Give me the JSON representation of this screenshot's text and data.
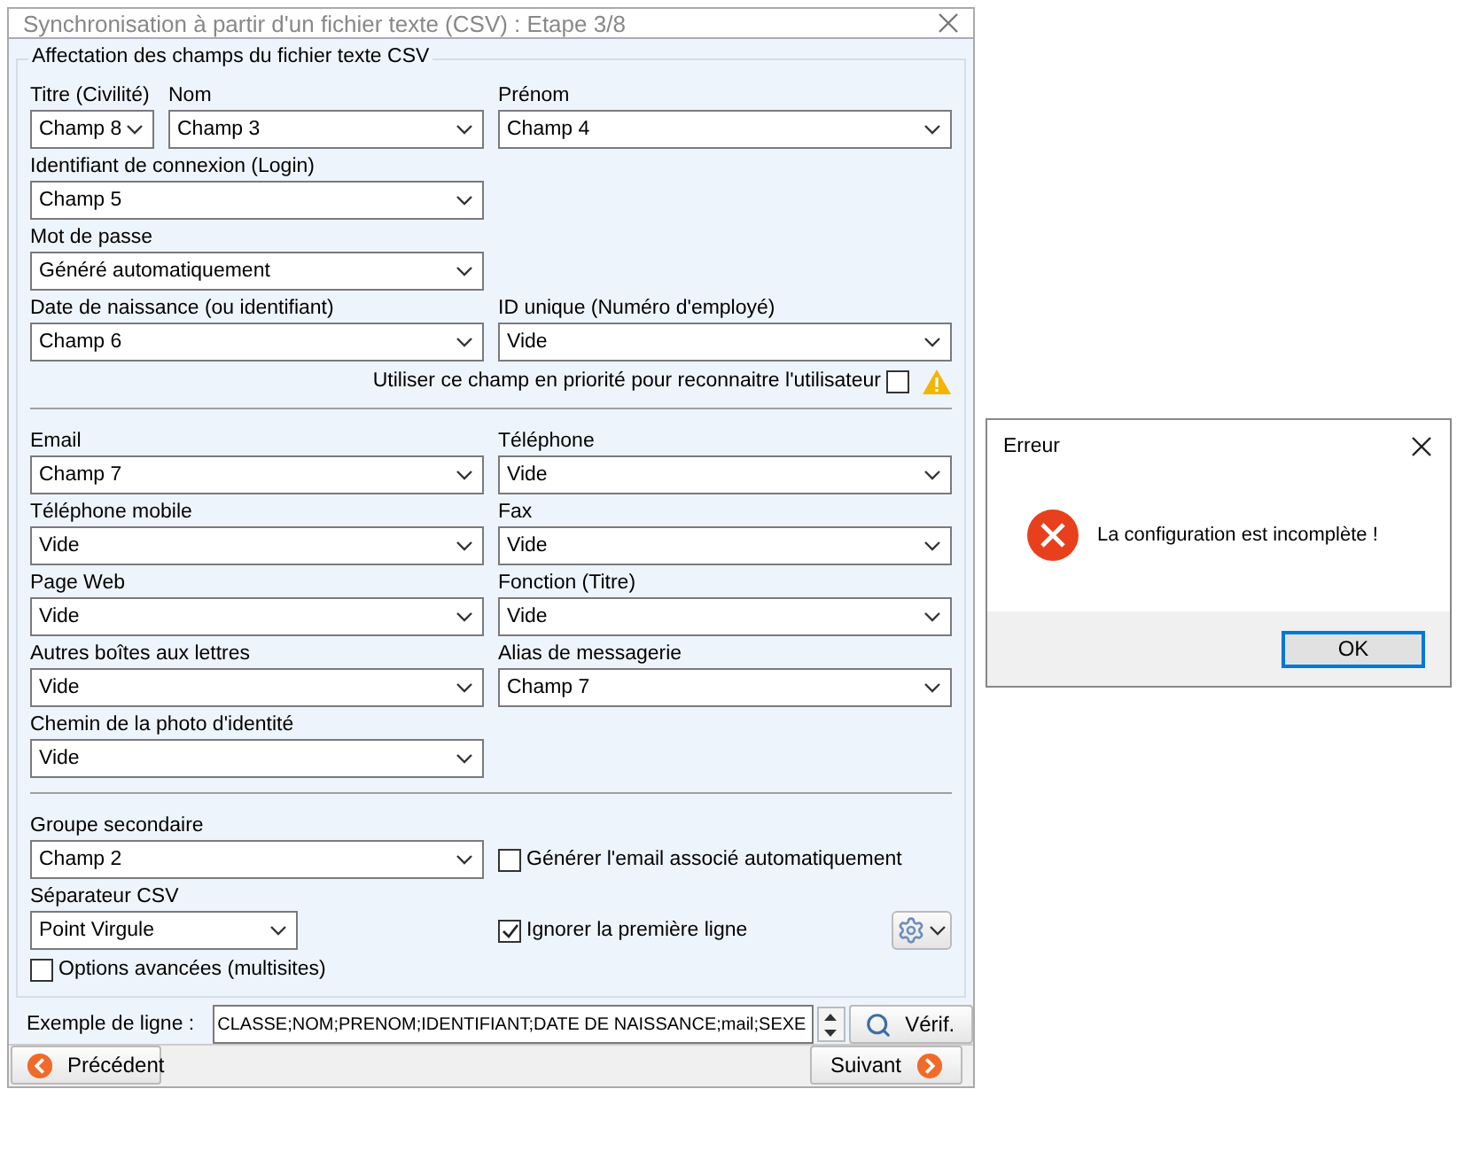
{
  "window": {
    "title": "Synchronisation à partir d'un fichier texte (CSV) : Etape 3/8"
  },
  "group": {
    "title": "Affectation des champs du fichier texte CSV"
  },
  "identity_rows": [
    {
      "fields": [
        {
          "label": "Titre (Civilité)",
          "value": "Champ 8"
        },
        {
          "label": "Nom",
          "value": "Champ 3"
        },
        {
          "label": "Prénom",
          "value": "Champ 4"
        }
      ]
    },
    {
      "fields": [
        {
          "label": "Identifiant de connexion (Login)",
          "value": "Champ 5"
        }
      ]
    },
    {
      "fields": [
        {
          "label": "Mot de passe",
          "value": "Généré automatiquement"
        }
      ]
    },
    {
      "fields": [
        {
          "label": "Date de naissance (ou identifiant)",
          "value": "Champ 6"
        },
        {
          "label": "ID unique (Numéro d'employé)",
          "value": "Vide"
        }
      ]
    }
  ],
  "priority_option": {
    "label": "Utiliser ce champ en priorité pour reconnaitre l'utilisateur",
    "checked": false
  },
  "contact_rows": [
    {
      "fields": [
        {
          "label": "Email",
          "value": "Champ 7"
        },
        {
          "label": "Téléphone",
          "value": "Vide"
        }
      ]
    },
    {
      "fields": [
        {
          "label": "Téléphone mobile",
          "value": "Vide"
        },
        {
          "label": "Fax",
          "value": "Vide"
        }
      ]
    },
    {
      "fields": [
        {
          "label": "Page Web",
          "value": "Vide"
        },
        {
          "label": "Fonction (Titre)",
          "value": "Vide"
        }
      ]
    },
    {
      "fields": [
        {
          "label": "Autres boîtes aux lettres",
          "value": "Vide"
        },
        {
          "label": "Alias de messagerie",
          "value": "Champ 7"
        }
      ]
    },
    {
      "fields": [
        {
          "label": "Chemin de la photo d'identité",
          "value": "Vide"
        }
      ]
    }
  ],
  "secondary_group": {
    "label": "Groupe secondaire",
    "value": "Champ 2"
  },
  "generate_email": {
    "label": "Générer l'email associé automatiquement",
    "checked": false
  },
  "separator": {
    "label": "Séparateur CSV",
    "value": "Point Virgule"
  },
  "skip_first_line": {
    "label": "Ignorer la première ligne",
    "checked": true
  },
  "advanced_options": {
    "label": "Options avancées (multisites)",
    "checked": false
  },
  "example_line": {
    "label": "Exemple de ligne :",
    "value": "CLASSE;NOM;PRENOM;IDENTIFIANT;DATE DE NAISSANCE;mail;SEXE",
    "button": "Vérif."
  },
  "footer": {
    "previous": "Précédent",
    "next": "Suivant"
  },
  "error_dialog": {
    "title": "Erreur",
    "message": "La configuration est incomplète !",
    "button": "OK"
  }
}
